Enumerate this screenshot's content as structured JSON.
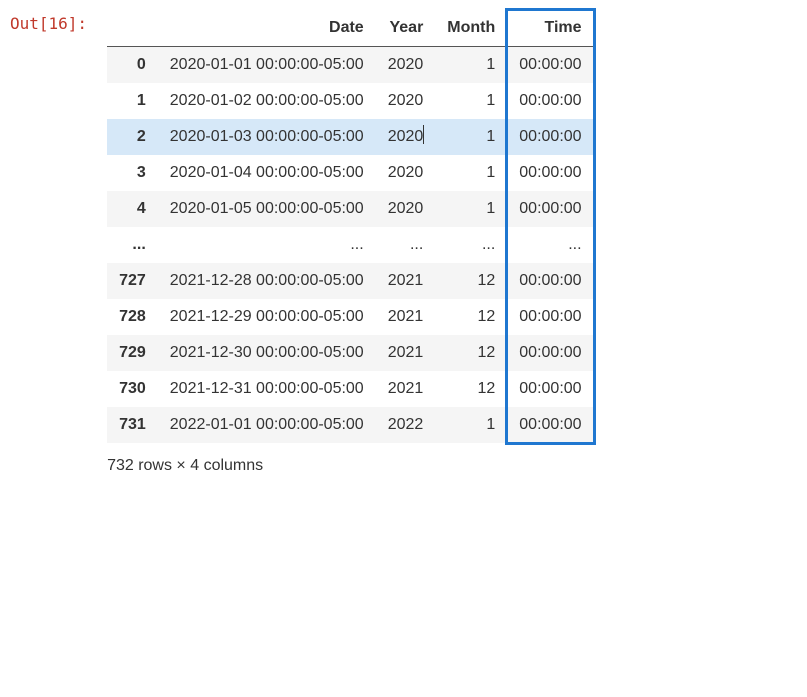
{
  "prompt": "Out[16]:",
  "headers": [
    "",
    "Date",
    "Year",
    "Month",
    "Time"
  ],
  "rows": [
    {
      "idx": "0",
      "date": "2020-01-01 00:00:00-05:00",
      "year": "2020",
      "month": "1",
      "time": "00:00:00",
      "parity": "even"
    },
    {
      "idx": "1",
      "date": "2020-01-02 00:00:00-05:00",
      "year": "2020",
      "month": "1",
      "time": "00:00:00",
      "parity": "odd"
    },
    {
      "idx": "2",
      "date": "2020-01-03 00:00:00-05:00",
      "year": "2020",
      "month": "1",
      "time": "00:00:00",
      "parity": "hovered",
      "cursor": true
    },
    {
      "idx": "3",
      "date": "2020-01-04 00:00:00-05:00",
      "year": "2020",
      "month": "1",
      "time": "00:00:00",
      "parity": "odd"
    },
    {
      "idx": "4",
      "date": "2020-01-05 00:00:00-05:00",
      "year": "2020",
      "month": "1",
      "time": "00:00:00",
      "parity": "even"
    },
    {
      "idx": "...",
      "date": "...",
      "year": "...",
      "month": "...",
      "time": "...",
      "parity": "odd"
    },
    {
      "idx": "727",
      "date": "2021-12-28 00:00:00-05:00",
      "year": "2021",
      "month": "12",
      "time": "00:00:00",
      "parity": "even"
    },
    {
      "idx": "728",
      "date": "2021-12-29 00:00:00-05:00",
      "year": "2021",
      "month": "12",
      "time": "00:00:00",
      "parity": "odd"
    },
    {
      "idx": "729",
      "date": "2021-12-30 00:00:00-05:00",
      "year": "2021",
      "month": "12",
      "time": "00:00:00",
      "parity": "even"
    },
    {
      "idx": "730",
      "date": "2021-12-31 00:00:00-05:00",
      "year": "2021",
      "month": "12",
      "time": "00:00:00",
      "parity": "odd"
    },
    {
      "idx": "731",
      "date": "2022-01-01 00:00:00-05:00",
      "year": "2022",
      "month": "1",
      "time": "00:00:00",
      "parity": "even"
    }
  ],
  "summary": "732 rows × 4 columns",
  "highlight_column": "Time"
}
